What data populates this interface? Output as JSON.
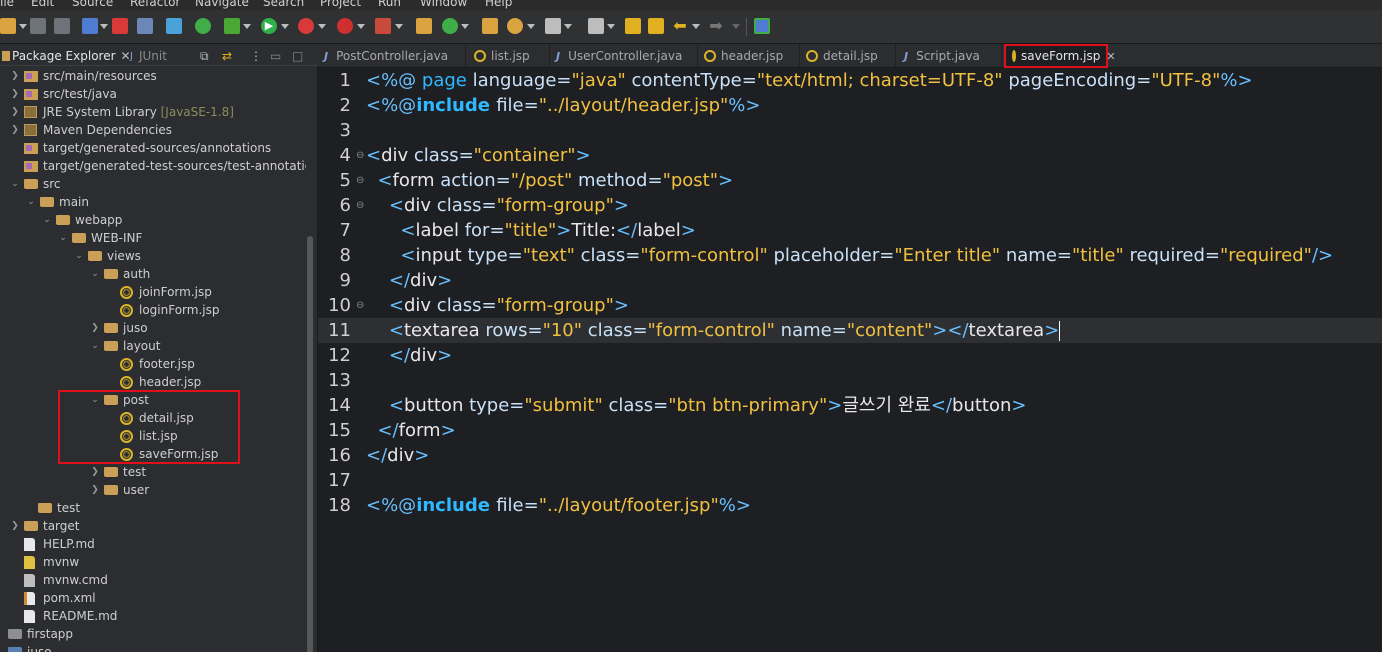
{
  "menu": [
    "ile",
    "Edit",
    "Source",
    "Refactor",
    "Navigate",
    "Search",
    "Project",
    "Run",
    "Window",
    "Help"
  ],
  "left_tabs": {
    "package_explorer": "Package Explorer",
    "junit": "JUnit"
  },
  "tree": [
    {
      "label": "src/main/resources",
      "icon": "package-folder-icon"
    },
    {
      "label": "src/test/java",
      "icon": "package-folder-icon"
    },
    {
      "label": "JRE System Library",
      "suffix": "[JavaSE-1.8]",
      "icon": "library-icon"
    },
    {
      "label": "Maven Dependencies",
      "icon": "library-icon"
    },
    {
      "label": "target/generated-sources/annotations",
      "icon": "package-folder-icon"
    },
    {
      "label": "target/generated-test-sources/test-annotations",
      "icon": "package-folder-icon"
    },
    {
      "label": "src",
      "icon": "folder-icon"
    },
    {
      "label": "main",
      "icon": "folder-icon"
    },
    {
      "label": "webapp",
      "icon": "folder-icon"
    },
    {
      "label": "WEB-INF",
      "icon": "folder-icon"
    },
    {
      "label": "views",
      "icon": "folder-icon"
    },
    {
      "label": "auth",
      "icon": "folder-icon"
    },
    {
      "label": "joinForm.jsp",
      "icon": "jsp-file-icon"
    },
    {
      "label": "loginForm.jsp",
      "icon": "jsp-file-icon"
    },
    {
      "label": "juso",
      "icon": "folder-icon"
    },
    {
      "label": "layout",
      "icon": "folder-icon"
    },
    {
      "label": "footer.jsp",
      "icon": "jsp-file-icon"
    },
    {
      "label": "header.jsp",
      "icon": "jsp-file-icon"
    },
    {
      "label": "post",
      "icon": "folder-icon"
    },
    {
      "label": "detail.jsp",
      "icon": "jsp-file-icon"
    },
    {
      "label": "list.jsp",
      "icon": "jsp-file-icon"
    },
    {
      "label": "saveForm.jsp",
      "icon": "jsp-file-icon"
    },
    {
      "label": "test",
      "icon": "folder-icon"
    },
    {
      "label": "user",
      "icon": "folder-icon"
    },
    {
      "label": "test",
      "icon": "folder-icon"
    },
    {
      "label": "target",
      "icon": "folder-icon"
    },
    {
      "label": "HELP.md",
      "icon": "file-icon"
    },
    {
      "label": "mvnw",
      "icon": "file-icon"
    },
    {
      "label": "mvnw.cmd",
      "icon": "file-icon"
    },
    {
      "label": "pom.xml",
      "icon": "xml-file-icon"
    },
    {
      "label": "README.md",
      "icon": "file-icon"
    },
    {
      "label": "firstapp",
      "icon": "project-icon"
    },
    {
      "label": "juso",
      "icon": "project-icon"
    }
  ],
  "editor_tabs": [
    {
      "label": "PostController.java",
      "type": "java"
    },
    {
      "label": "list.jsp",
      "type": "jsp"
    },
    {
      "label": "UserController.java",
      "type": "java"
    },
    {
      "label": "header.jsp",
      "type": "jsp"
    },
    {
      "label": "detail.jsp",
      "type": "jsp"
    },
    {
      "label": "Script.java",
      "type": "java"
    },
    {
      "label": "saveForm.jsp",
      "type": "jsp",
      "active": true
    }
  ],
  "code_lines": [
    {
      "n": "1",
      "segments": [
        [
          "tag",
          "<%@ "
        ],
        [
          "kw2",
          "page "
        ],
        [
          "attr",
          "language="
        ],
        [
          "str",
          "\"java\" "
        ],
        [
          "attr",
          "contentType="
        ],
        [
          "str",
          "\"text/html; charset=UTF-8\" "
        ],
        [
          "attr",
          "pageEncoding="
        ],
        [
          "str",
          "\"UTF-8\""
        ],
        [
          "tag",
          "%>"
        ]
      ]
    },
    {
      "n": "2",
      "segments": [
        [
          "tag",
          "<%@"
        ],
        [
          "kw",
          "include "
        ],
        [
          "attr",
          "file="
        ],
        [
          "str",
          "\"../layout/header.jsp\""
        ],
        [
          "tag",
          "%>"
        ]
      ]
    },
    {
      "n": "3",
      "segments": []
    },
    {
      "n": "4",
      "fold": true,
      "segments": [
        [
          "tag",
          "<"
        ],
        [
          "tagname",
          "div "
        ],
        [
          "attr",
          "class="
        ],
        [
          "str",
          "\"container\""
        ],
        [
          "tag",
          ">"
        ]
      ]
    },
    {
      "n": "5",
      "fold": true,
      "segments": [
        [
          "ktext",
          "  "
        ],
        [
          "tag",
          "<"
        ],
        [
          "tagname",
          "form "
        ],
        [
          "attr",
          "action="
        ],
        [
          "str",
          "\"/post\" "
        ],
        [
          "attr",
          "method="
        ],
        [
          "str",
          "\"post\""
        ],
        [
          "tag",
          ">"
        ]
      ]
    },
    {
      "n": "6",
      "fold": true,
      "segments": [
        [
          "ktext",
          "    "
        ],
        [
          "tag",
          "<"
        ],
        [
          "tagname",
          "div "
        ],
        [
          "attr",
          "class="
        ],
        [
          "str",
          "\"form-group\""
        ],
        [
          "tag",
          ">"
        ]
      ]
    },
    {
      "n": "7",
      "segments": [
        [
          "ktext",
          "      "
        ],
        [
          "tag",
          "<"
        ],
        [
          "tagname",
          "label "
        ],
        [
          "attr",
          "for="
        ],
        [
          "str",
          "\"title\""
        ],
        [
          "tag",
          ">"
        ],
        [
          "ktext",
          "Title:"
        ],
        [
          "tag",
          "</"
        ],
        [
          "tagname",
          "label"
        ],
        [
          "tag",
          ">"
        ]
      ]
    },
    {
      "n": "8",
      "segments": [
        [
          "ktext",
          "      "
        ],
        [
          "tag",
          "<"
        ],
        [
          "tagname",
          "input "
        ],
        [
          "attr",
          "type="
        ],
        [
          "str",
          "\"text\" "
        ],
        [
          "attr",
          "class="
        ],
        [
          "str",
          "\"form-control\" "
        ],
        [
          "attr",
          "placeholder="
        ],
        [
          "str",
          "\"Enter title\" "
        ],
        [
          "attr",
          "name="
        ],
        [
          "str",
          "\"title\" "
        ],
        [
          "attr",
          "required="
        ],
        [
          "str",
          "\"required\""
        ],
        [
          "tag",
          "/>"
        ]
      ]
    },
    {
      "n": "9",
      "segments": [
        [
          "ktext",
          "    "
        ],
        [
          "tag",
          "</"
        ],
        [
          "tagname",
          "div"
        ],
        [
          "tag",
          ">"
        ]
      ]
    },
    {
      "n": "10",
      "fold": true,
      "segments": [
        [
          "ktext",
          "    "
        ],
        [
          "tag",
          "<"
        ],
        [
          "tagname",
          "div "
        ],
        [
          "attr",
          "class="
        ],
        [
          "str",
          "\"form-group\""
        ],
        [
          "tag",
          ">"
        ]
      ]
    },
    {
      "n": "11",
      "current": true,
      "segments": [
        [
          "ktext",
          "    "
        ],
        [
          "tag",
          "<"
        ],
        [
          "tagname",
          "textarea "
        ],
        [
          "attr",
          "rows="
        ],
        [
          "str",
          "\"10\" "
        ],
        [
          "attr",
          "class="
        ],
        [
          "str",
          "\"form-control\" "
        ],
        [
          "attr",
          "name="
        ],
        [
          "str",
          "\"content\""
        ],
        [
          "tag",
          "></"
        ],
        [
          "tagname",
          "textarea"
        ],
        [
          "tag",
          ">"
        ]
      ]
    },
    {
      "n": "12",
      "segments": [
        [
          "ktext",
          "    "
        ],
        [
          "tag",
          "</"
        ],
        [
          "tagname",
          "div"
        ],
        [
          "tag",
          ">"
        ]
      ]
    },
    {
      "n": "13",
      "segments": []
    },
    {
      "n": "14",
      "segments": [
        [
          "ktext",
          "    "
        ],
        [
          "tag",
          "<"
        ],
        [
          "tagname",
          "button "
        ],
        [
          "attr",
          "type="
        ],
        [
          "str",
          "\"submit\" "
        ],
        [
          "attr",
          "class="
        ],
        [
          "str",
          "\"btn btn-primary\""
        ],
        [
          "tag",
          ">"
        ],
        [
          "ktext",
          "글쓰기 완료"
        ],
        [
          "tag",
          "</"
        ],
        [
          "tagname",
          "button"
        ],
        [
          "tag",
          ">"
        ]
      ]
    },
    {
      "n": "15",
      "segments": [
        [
          "ktext",
          "  "
        ],
        [
          "tag",
          "</"
        ],
        [
          "tagname",
          "form"
        ],
        [
          "tag",
          ">"
        ]
      ]
    },
    {
      "n": "16",
      "segments": [
        [
          "tag",
          "</"
        ],
        [
          "tagname",
          "div"
        ],
        [
          "tag",
          ">"
        ]
      ]
    },
    {
      "n": "17",
      "segments": []
    },
    {
      "n": "18",
      "segments": [
        [
          "tag",
          "<%@"
        ],
        [
          "kw",
          "include "
        ],
        [
          "attr",
          "file="
        ],
        [
          "str",
          "\"../layout/footer.jsp\""
        ],
        [
          "tag",
          "%>"
        ]
      ]
    }
  ]
}
